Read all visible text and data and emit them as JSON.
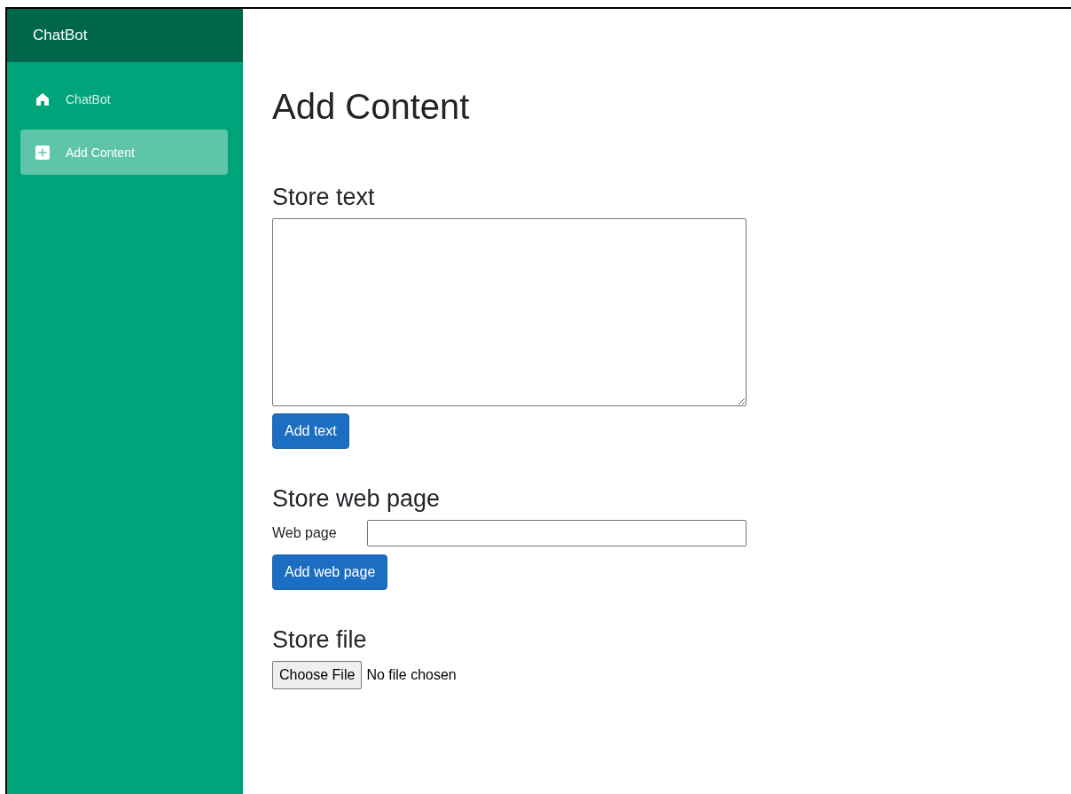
{
  "sidebar": {
    "brand": "ChatBot",
    "items": [
      {
        "label": "ChatBot",
        "selected": false
      },
      {
        "label": "Add Content",
        "selected": true
      }
    ]
  },
  "page_title": "Add Content",
  "sections": [
    {
      "kind": "text",
      "heading": "Store text",
      "button": "Add text"
    },
    {
      "kind": "url",
      "heading": "Store web page",
      "label": "Web page",
      "button": "Add web page"
    },
    {
      "kind": "file",
      "heading": "Store file",
      "button": "Choose File",
      "status": "No file chosen"
    }
  ]
}
